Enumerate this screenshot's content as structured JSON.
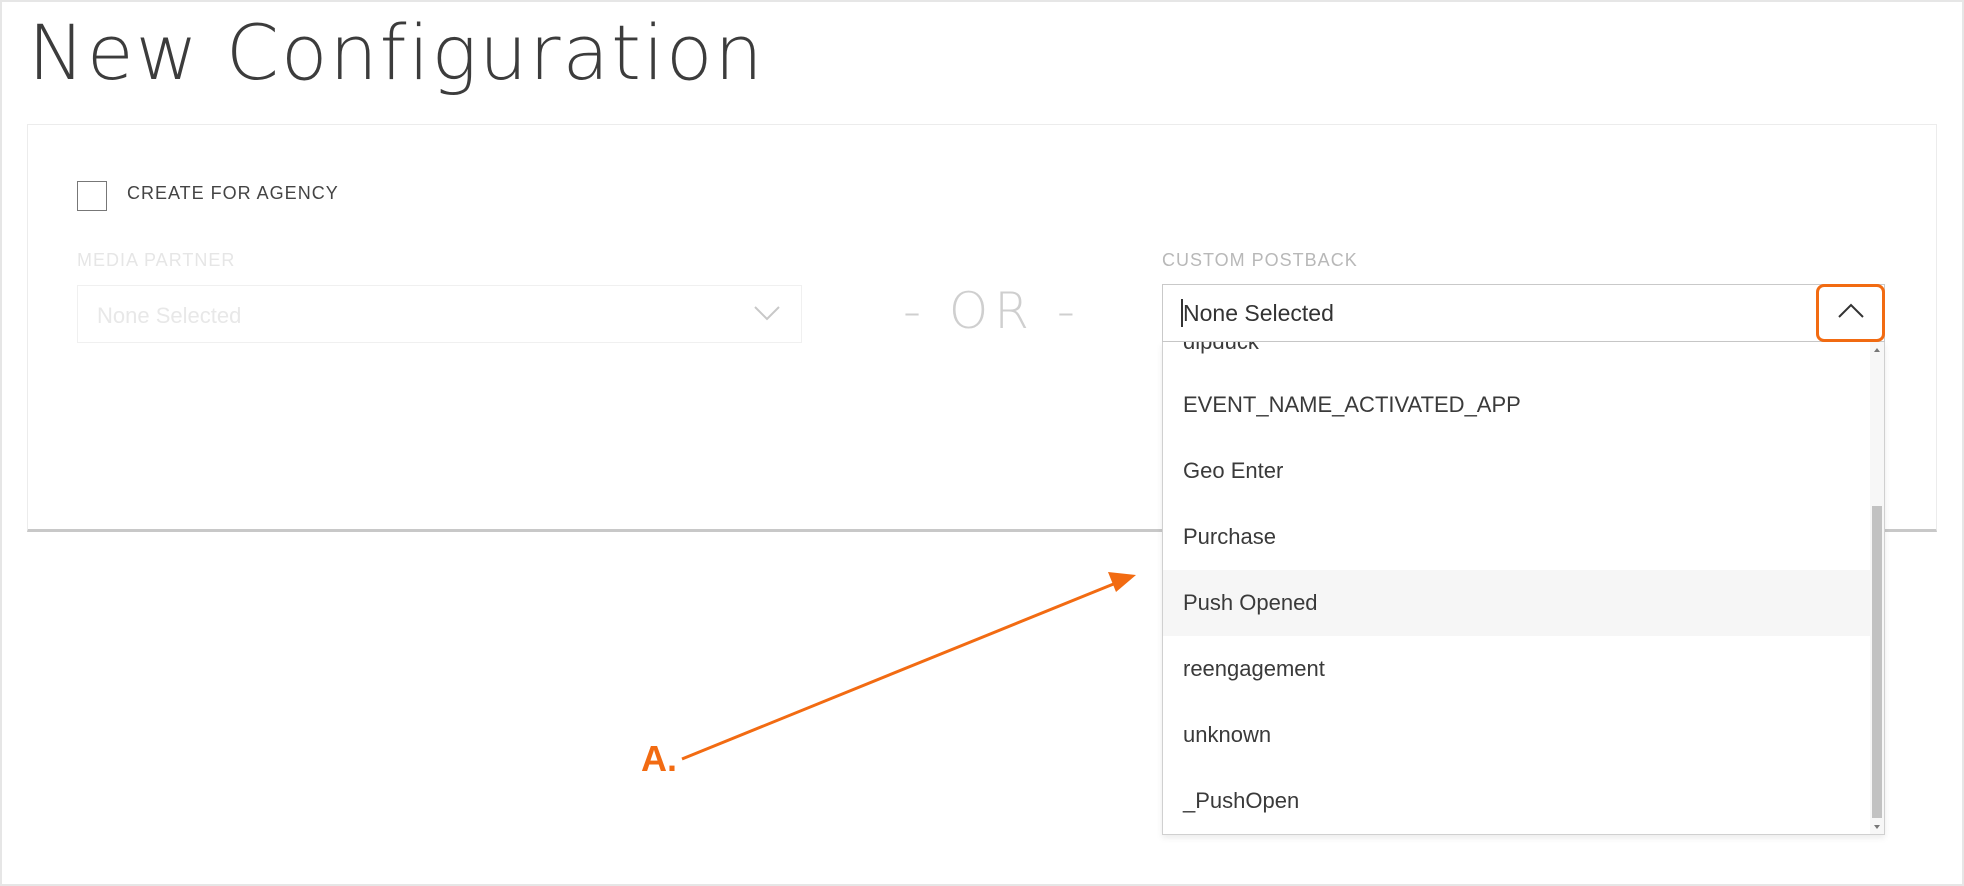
{
  "page": {
    "title": "New Configuration"
  },
  "agency": {
    "label": "CREATE FOR AGENCY",
    "checked": false
  },
  "media_partner": {
    "label": "MEDIA PARTNER",
    "value": "None Selected"
  },
  "separator": "- OR -",
  "custom_postback": {
    "label": "CUSTOM POSTBACK",
    "value": "None Selected",
    "options": [
      "dipduck",
      "EVENT_NAME_ACTIVATED_APP",
      "Geo Enter",
      "Purchase",
      "Push Opened",
      "reengagement",
      "unknown",
      "_PushOpen"
    ],
    "hovered_option": "Push Opened"
  },
  "annotation": {
    "label": "A."
  },
  "colors": {
    "accent": "#f26b12",
    "text": "#3a3a3a",
    "muted": "#b8b8b8",
    "hover": "#f6f6f6"
  },
  "icons": {
    "media_select": "chevron-down-icon",
    "toggle": "chevron-up-icon"
  }
}
